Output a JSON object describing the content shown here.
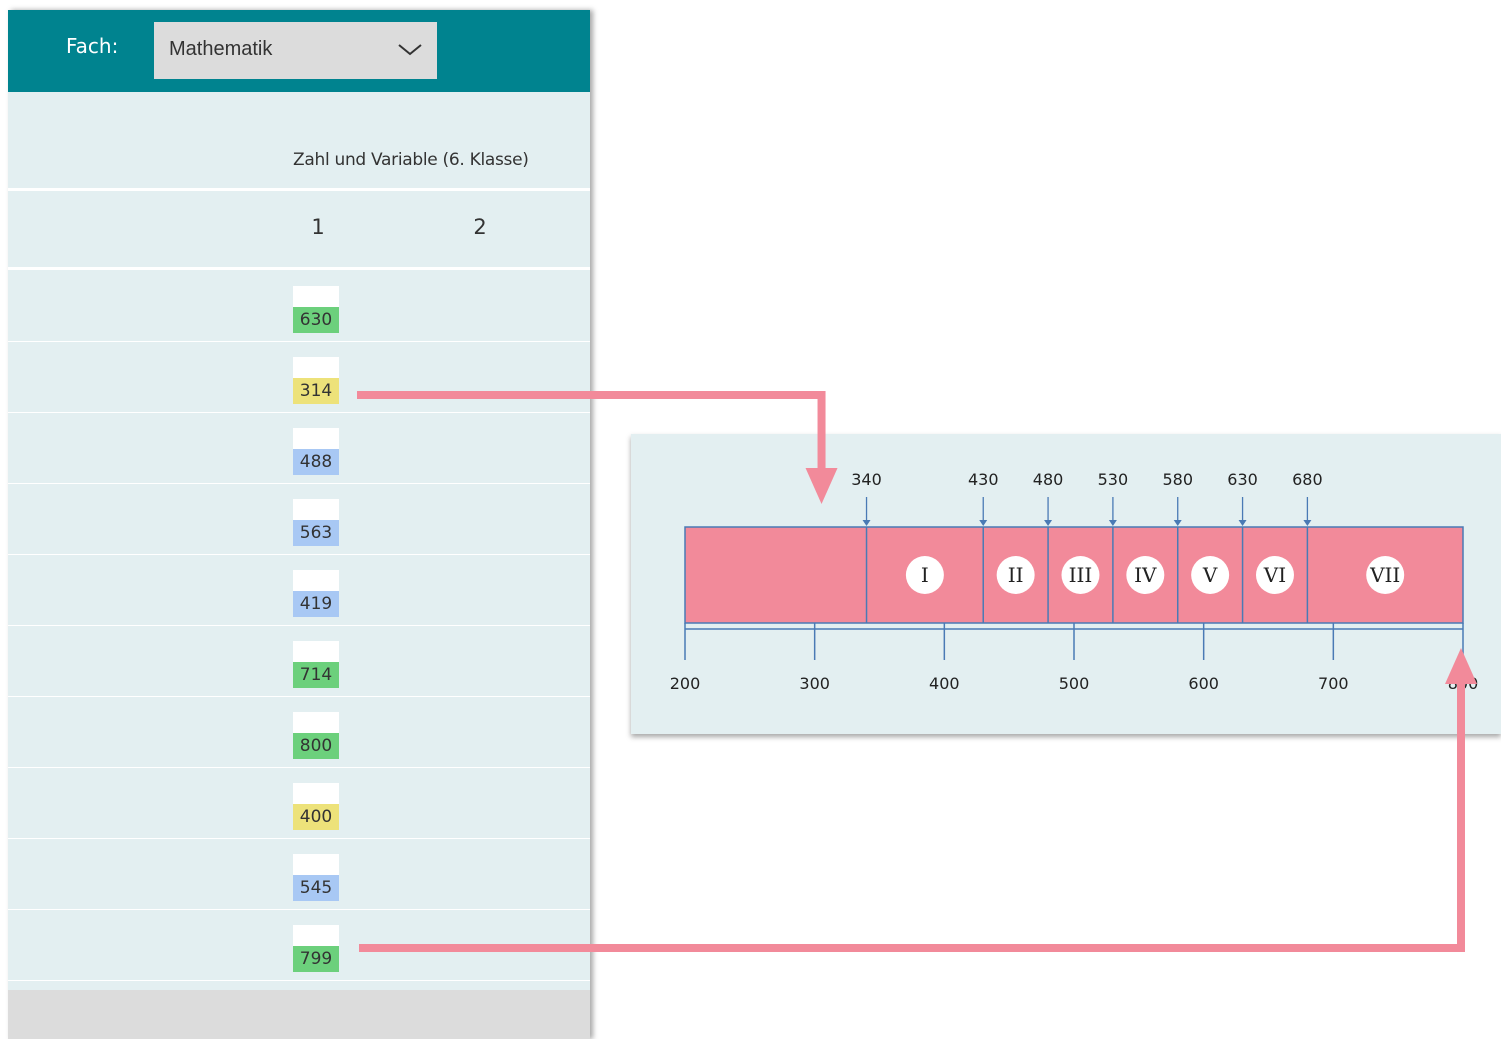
{
  "header": {
    "subject_label": "Fach:",
    "subject_value": "Mathematik"
  },
  "table": {
    "group_title": "Zahl und Variable (6. Klasse)",
    "columns": [
      "1",
      "2"
    ],
    "rows": [
      {
        "value": "630",
        "level": "green"
      },
      {
        "value": "314",
        "level": "yellow"
      },
      {
        "value": "488",
        "level": "blue"
      },
      {
        "value": "563",
        "level": "blue"
      },
      {
        "value": "419",
        "level": "blue"
      },
      {
        "value": "714",
        "level": "green"
      },
      {
        "value": "800",
        "level": "green"
      },
      {
        "value": "400",
        "level": "yellow"
      },
      {
        "value": "545",
        "level": "blue"
      },
      {
        "value": "799",
        "level": "green"
      }
    ]
  },
  "colors": {
    "header": "#00838f",
    "panel": "#e3eff1",
    "green": "#6cd07c",
    "yellow": "#ede27a",
    "blue": "#a8c8f4",
    "scale_fill": "#f28a9a",
    "scale_stroke": "#4a7ab5",
    "arrow": "#f28a9a"
  },
  "scale": {
    "axis_min": 200,
    "axis_max": 800,
    "axis_ticks": [
      "200",
      "300",
      "400",
      "500",
      "600",
      "700",
      "800"
    ],
    "thresholds": [
      "340",
      "430",
      "480",
      "530",
      "580",
      "630",
      "680"
    ],
    "levels": [
      "I",
      "II",
      "III",
      "IV",
      "V",
      "VI",
      "VII"
    ]
  },
  "arrows": [
    {
      "from_value": "314",
      "to_value": 340
    },
    {
      "from_value": "799",
      "to_value": 800
    }
  ],
  "icons": {
    "dropdown": "chevron-down-icon",
    "arrow": "arrow-down-icon"
  }
}
